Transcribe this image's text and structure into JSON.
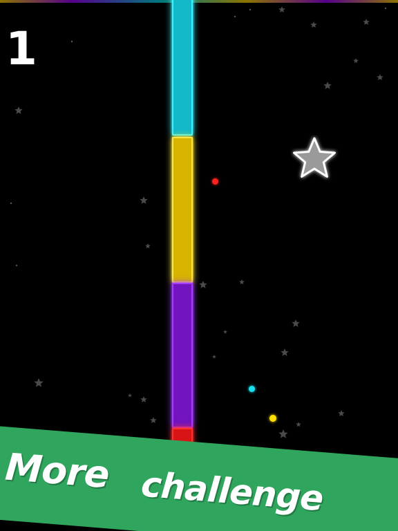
{
  "game": {
    "score": "1",
    "banner_text": [
      "More",
      "challenge"
    ]
  },
  "colors": {
    "background": "#000000",
    "cyan": "#14c8dc",
    "yellow": "#e2c200",
    "purple": "#7a14c8",
    "red": "#e01818",
    "banner_green": "#2fa55e"
  },
  "column": {
    "segments": [
      {
        "name": "cyan-segment",
        "color": "#13b9c9",
        "glow": "#3af3ff"
      },
      {
        "name": "yellow-segment",
        "color": "#d6b400",
        "glow": "#ffe640"
      },
      {
        "name": "purple-segment",
        "color": "#7214c0",
        "glow": "#a43cff"
      },
      {
        "name": "red-segment",
        "color": "#d81414",
        "glow": "#ff3030"
      }
    ]
  },
  "icons": {
    "collectible": "star-icon",
    "background": "background-star-icon"
  }
}
